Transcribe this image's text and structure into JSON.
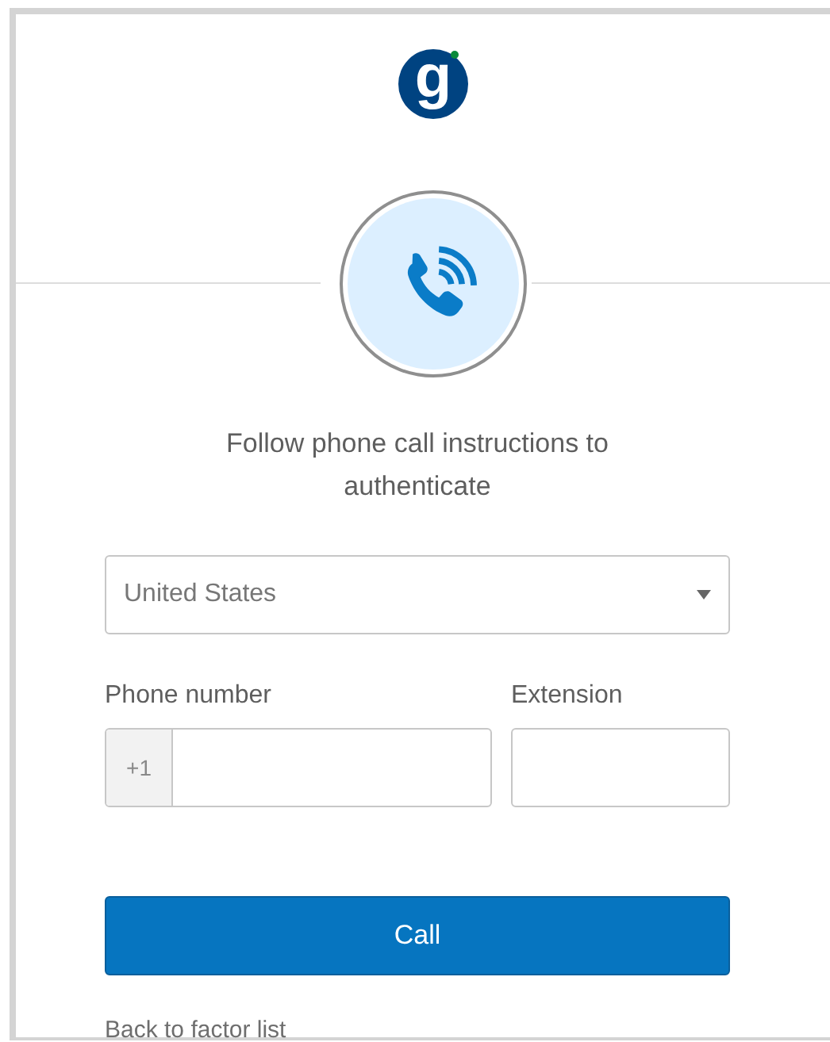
{
  "logo": {
    "letter": "g"
  },
  "heading": "Follow phone call instructions to authenticate",
  "country_select": {
    "value": "United States"
  },
  "phone_number": {
    "label": "Phone number",
    "prefix": "+1"
  },
  "extension": {
    "label": "Extension"
  },
  "call_button": "Call",
  "back_link": "Back to factor list"
}
